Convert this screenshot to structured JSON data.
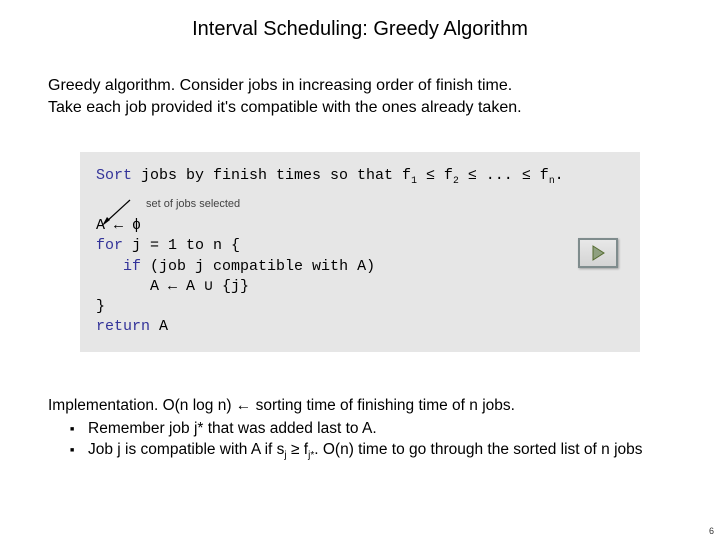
{
  "title": "Interval Scheduling: Greedy Algorithm",
  "intro_line1_label": "Greedy algorithm.",
  "intro_line1_rest": " Consider jobs in increasing order of finish time.",
  "intro_line2": "Take each job provided it's compatible with the ones already taken.",
  "code": {
    "sort_kw": "Sort",
    "sort_rest_a": " jobs by finish times so that f",
    "sort_sub1": "1",
    "sort_le1": " ≤ f",
    "sort_sub2": "2",
    "sort_le2": " ≤ ... ≤ f",
    "sort_subn": "n",
    "sort_end": ".",
    "annotation": "set of jobs selected",
    "l1": "A ← ϕ",
    "l2_kw": "for",
    "l2_rest": " j = 1 to n {",
    "l3_indent": "   ",
    "l3_kw": "if",
    "l3_rest": " (job j compatible with A)",
    "l4": "      A ← A ∪ {j}",
    "l5": "}",
    "l6_kw": "return",
    "l6_rest": " A"
  },
  "impl_label": "Implementation.",
  "impl_rest": " O(n log n) ← sorting time of finishing time of n jobs.",
  "bullet1": "Remember job j* that was added last to A.",
  "bullet2_a": "Job j is compatible with A if s",
  "bullet2_subj": "j",
  "bullet2_mid": " ≥ f",
  "bullet2_subjs": "j*",
  "bullet2_b": ". O(n) time to go through the sorted list of n jobs",
  "page_number": "6"
}
